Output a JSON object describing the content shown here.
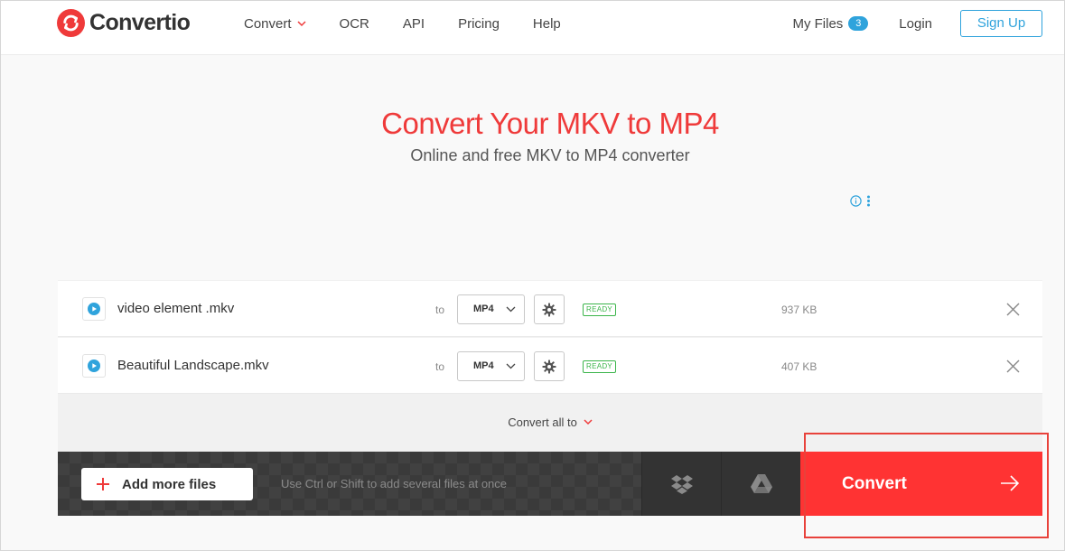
{
  "brand": {
    "name": "Convertio",
    "color": "#ef3a3a"
  },
  "nav": {
    "items": [
      {
        "label": "Convert",
        "has_dropdown": true
      },
      {
        "label": "OCR"
      },
      {
        "label": "API"
      },
      {
        "label": "Pricing"
      },
      {
        "label": "Help"
      }
    ],
    "my_files_label": "My Files",
    "my_files_count": "3",
    "login_label": "Login",
    "signup_label": "Sign Up",
    "accent": "#2fa3dc"
  },
  "hero": {
    "title": "Convert Your MKV to MP4",
    "subtitle": "Online and free MKV to MP4 converter"
  },
  "files": [
    {
      "name": "video element .mkv",
      "to_label": "to",
      "format": "MP4",
      "status": "READY",
      "size": "937 KB",
      "icon": "play-icon"
    },
    {
      "name": "Beautiful Landscape.mkv",
      "to_label": "to",
      "format": "MP4",
      "status": "READY",
      "size": "407 KB",
      "icon": "play-icon"
    }
  ],
  "convert_all": {
    "label": "Convert all to"
  },
  "actions": {
    "add_more_label": "Add more files",
    "hint": "Use Ctrl or Shift to add several files at once",
    "convert_label": "Convert",
    "cloud_icons": [
      "dropbox-icon",
      "google-drive-icon"
    ],
    "convert_color": "#ff3333"
  }
}
